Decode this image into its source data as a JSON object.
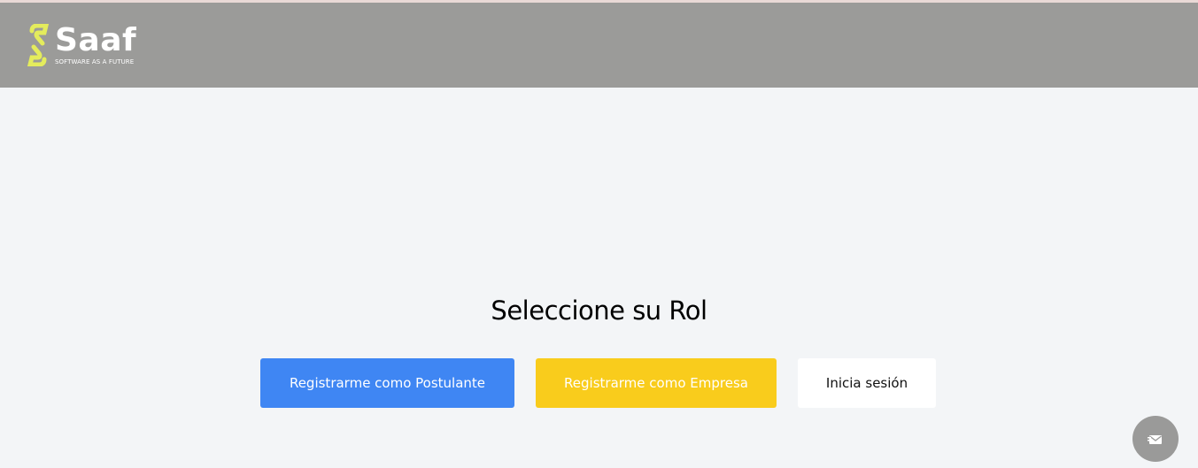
{
  "header": {
    "logo_word": "Saaf",
    "logo_tagline": "SOFTWARE AS A FUTURE"
  },
  "main": {
    "title": "Seleccione su Rol",
    "buttons": {
      "postulante": "Registrarme como Postulante",
      "empresa": "Registrarme como Empresa",
      "login": "Inicia sesión"
    }
  },
  "fab": {
    "icon": "mail-icon"
  },
  "colors": {
    "header_bg": "#9b9b99",
    "page_bg": "#f3f5f7",
    "logo_accent": "#e4ec5c",
    "postulante_btn": "#3f86f3",
    "empresa_btn": "#f9cc1c",
    "login_btn": "#ffffff",
    "fab_bg": "#9a9a99"
  }
}
